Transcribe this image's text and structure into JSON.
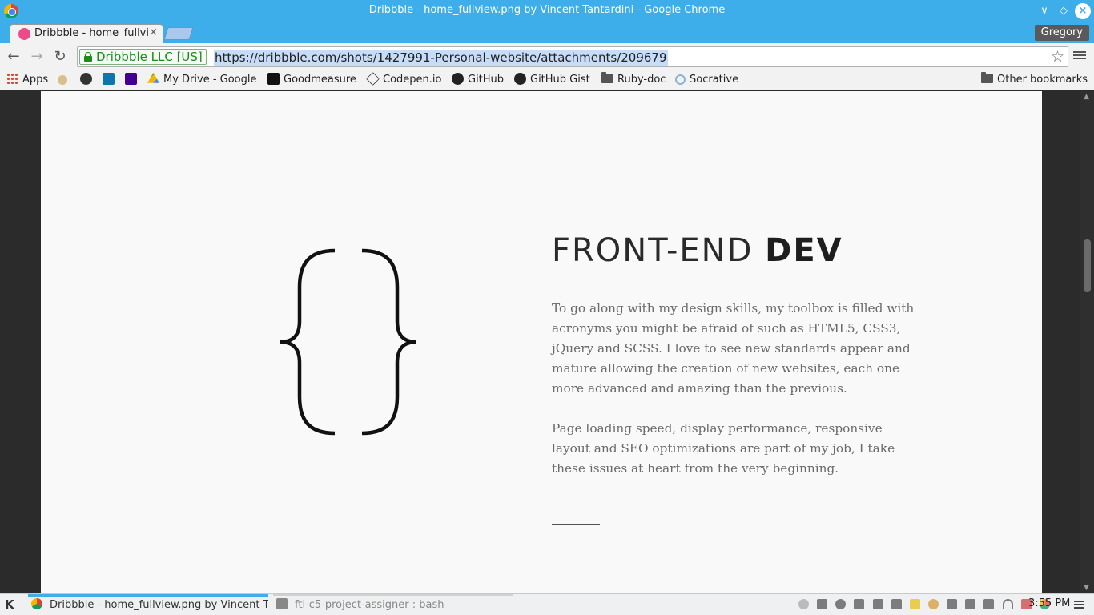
{
  "window": {
    "title": "Dribbble - home_fullview.png by Vincent Tantardini - Google Chrome"
  },
  "tabs": [
    {
      "label": "Dribbble - home_fullview.png by Vincent Tantardini",
      "close": "×"
    }
  ],
  "profile": {
    "name": "Gregory"
  },
  "omnibox": {
    "security_label": "Dribbble LLC [US]",
    "url": "https://dribbble.com/shots/1427991-Personal-website/attachments/209679"
  },
  "bookmarks": [
    {
      "label": "Apps",
      "icon": "apps-grid-icon"
    },
    {
      "label": "",
      "icon": "figure-icon"
    },
    {
      "label": "",
      "icon": "linkedin-round-icon"
    },
    {
      "label": "",
      "icon": "linkedin-icon"
    },
    {
      "label": "",
      "icon": "yahoo-icon"
    },
    {
      "label": "My Drive - Google",
      "icon": "google-drive-icon"
    },
    {
      "label": "Goodmeasure",
      "icon": "goodmeasure-icon"
    },
    {
      "label": "Codepen.io",
      "icon": "codepen-icon"
    },
    {
      "label": "GitHub",
      "icon": "github-icon"
    },
    {
      "label": "GitHub Gist",
      "icon": "github-icon"
    },
    {
      "label": "Ruby-doc",
      "icon": "folder-icon"
    },
    {
      "label": "Socrative",
      "icon": "socrative-icon"
    },
    {
      "label": "Other bookmarks",
      "icon": "folder-icon"
    }
  ],
  "page": {
    "heading_light": "FRONT-END ",
    "heading_bold": "DEV",
    "paragraph1": "To go along with my design skills, my toolbox is filled with acronyms you might be afraid of such as HTML5, CSS3, jQuery and SCSS. I love to see new standards appear and mature allowing the creation of new websites, each one more advanced and amazing than the previous.",
    "paragraph2": "Page loading speed, display performance, responsive layout and SEO optimizations are part of my job, I take these issues at heart from the very beginning."
  },
  "scroll": {
    "position_fraction": 0.32
  },
  "taskbar": {
    "tasks": [
      {
        "label": "Dribbble - home_fullview.png by Vincent Tantardini - Google Chrome",
        "active": true
      },
      {
        "label": "ftl-c5-project-assigner : bash",
        "active": false
      }
    ],
    "clock": "3:55 PM"
  },
  "colors": {
    "titlebar": "#3daee9",
    "dribbble_pink": "#ea4c89",
    "ev_green": "#1d8a1d",
    "page_bg": "#f9f9f9"
  }
}
